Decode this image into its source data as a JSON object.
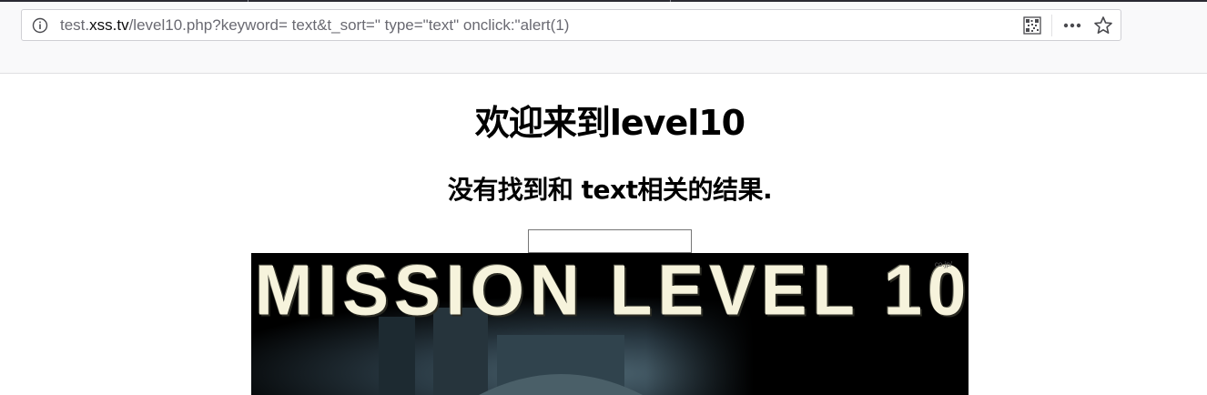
{
  "browser": {
    "url": {
      "prefix": "test.",
      "domain": "xss.tv",
      "path": "/level10.php?keyword= text&t_sort=\" type=\"text\" onclick:\"alert(1)"
    },
    "icons": {
      "info": "info-icon",
      "qr": "qr-code-icon",
      "more": "more-icon",
      "bookmark": "star-icon"
    }
  },
  "page": {
    "title": "欢迎来到level10",
    "result": "没有找到和 text相关的结果.",
    "keyword_value": "",
    "banner": {
      "title": "MISSION LEVEL 10",
      "watermark": "co.jp/"
    }
  }
}
